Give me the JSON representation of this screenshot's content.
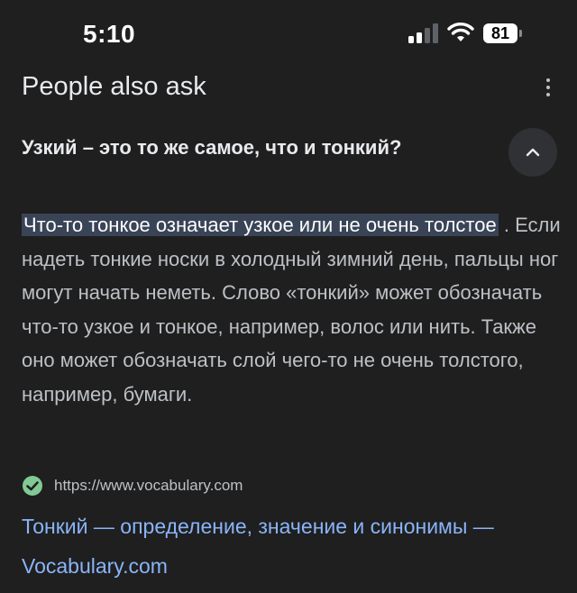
{
  "status_bar": {
    "time": "5:10",
    "battery": "81"
  },
  "header": {
    "title": "People also ask"
  },
  "question": {
    "text": "Узкий – это то же самое, что и тонкий?"
  },
  "answer": {
    "highlight": "Что-то тонкое означает узкое или не очень толстое",
    "body": " . Если надеть тонкие носки в холодный зимний день, пальцы ног могут начать неметь. Слово «тонкий» может обозначать что-то узкое и тонкое, например, волос или нить. Также оно может обозначать слой чего-то не очень толстого, например, бумаги."
  },
  "source": {
    "url": "https://www.vocabulary.com",
    "link_title": "Тонкий — определение, значение и синонимы — Vocabulary.com"
  },
  "colors": {
    "background": "#1f1f1f",
    "highlight": "#394457",
    "link": "#8ab4f8",
    "check": "#81c995"
  }
}
